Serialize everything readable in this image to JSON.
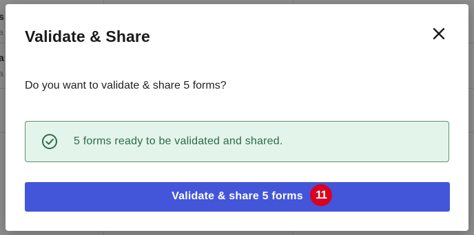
{
  "background": {
    "row_1_label": "s",
    "row_1_sub": "a",
    "row_2_label": "a",
    "row_2_sub": "a"
  },
  "dialog": {
    "title": "Validate & Share",
    "close_icon": "close-icon",
    "question": "Do you want to validate & share 5 forms?",
    "alert": {
      "icon": "check-circle-icon",
      "message": "5 forms ready to be validated and shared.",
      "background_color": "#e3f4eb",
      "border_color": "#5e8f6f",
      "text_color": "#2e6b47"
    },
    "primary_button": {
      "label": "Validate & share 5 forms",
      "color": "#4356d9"
    },
    "badge": {
      "value": "11",
      "color": "#d90020"
    }
  }
}
